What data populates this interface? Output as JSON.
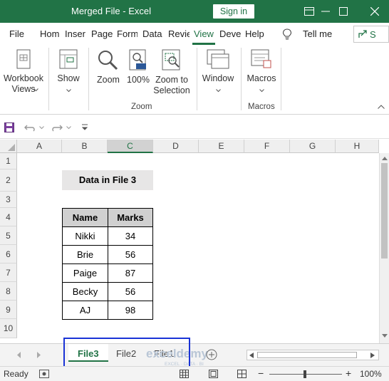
{
  "title_bar": {
    "title": "Merged File  -  Excel",
    "signin_label": "Sign in"
  },
  "ribbon_tabs": [
    {
      "label": "File"
    },
    {
      "label": "Hom"
    },
    {
      "label": "Inser"
    },
    {
      "label": "Page"
    },
    {
      "label": "Form"
    },
    {
      "label": "Data"
    },
    {
      "label": "Revie"
    },
    {
      "label": "View"
    },
    {
      "label": "Deve"
    },
    {
      "label": "Help"
    }
  ],
  "tell_me": "Tell me",
  "share_label": "S",
  "ribbon": {
    "workbook_views": "Workbook\nViews",
    "show": "Show",
    "zoom": "Zoom",
    "zoom100": "100%",
    "zoom_to_selection": "Zoom to\nSelection",
    "window": "Window",
    "macros": "Macros",
    "group_zoom": "Zoom",
    "group_macros": "Macros"
  },
  "columns": [
    "A",
    "B",
    "C",
    "D",
    "E",
    "F",
    "G",
    "H"
  ],
  "rows": [
    "1",
    "2",
    "3",
    "4",
    "5",
    "6",
    "7",
    "8",
    "9",
    "10"
  ],
  "sheet_heading": "Data in File 3",
  "table": {
    "headers": [
      "Name",
      "Marks"
    ],
    "rows": [
      [
        "Nikki",
        "34"
      ],
      [
        "Brie",
        "56"
      ],
      [
        "Paige",
        "87"
      ],
      [
        "Becky",
        "56"
      ],
      [
        "AJ",
        "98"
      ]
    ]
  },
  "sheets": [
    "File3",
    "File2",
    "File1"
  ],
  "watermark": "exceldemy",
  "watermark_sub": "EXCEL · DATA · BI",
  "status": {
    "ready": "Ready",
    "zoom": "100%"
  },
  "colors": {
    "excel_green": "#217346",
    "highlight_blue": "#1a33d6"
  }
}
